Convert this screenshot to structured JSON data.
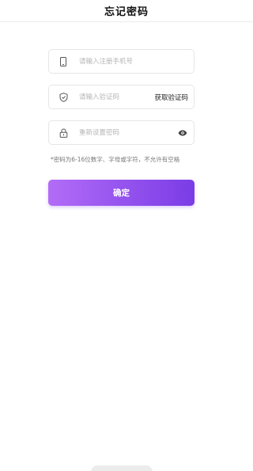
{
  "header": {
    "title": "忘记密码"
  },
  "form": {
    "phone": {
      "placeholder": "请输入注册手机号",
      "value": ""
    },
    "code": {
      "placeholder": "请输入验证码",
      "value": "",
      "action_label": "获取验证码"
    },
    "password": {
      "placeholder": "重新设置密码",
      "value": ""
    }
  },
  "hint": "*密码为6-16位数字、字母或字符，不允许有空格",
  "submit_label": "确定",
  "colors": {
    "accent_start": "#b26cf7",
    "accent_end": "#7a3ce6"
  }
}
